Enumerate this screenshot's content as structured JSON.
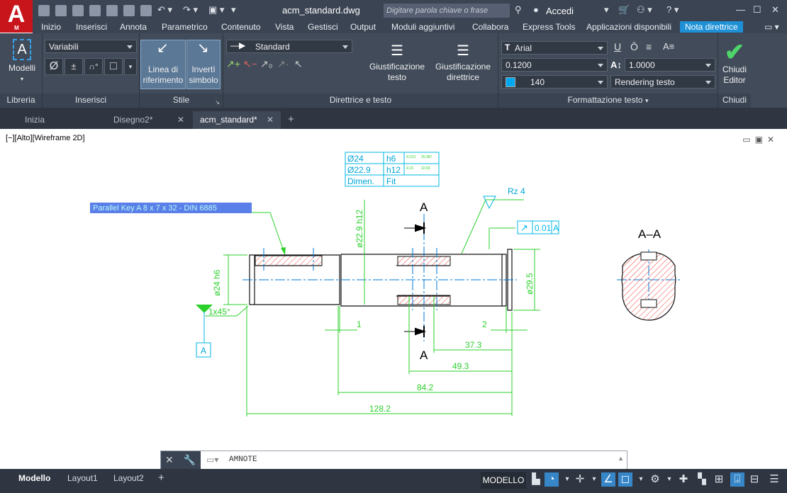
{
  "app": {
    "logo_letter": "A",
    "logo_sub": "M",
    "document_title": "acm_standard.dwg"
  },
  "search": {
    "placeholder": "Digitare parola chiave o frase"
  },
  "user": {
    "login": "Accedi"
  },
  "menu_tabs": [
    "Inizio",
    "Inserisci",
    "Annota",
    "Parametrico",
    "Contenuto",
    "Vista",
    "Gestisci",
    "Output",
    "Moduli aggiuntivi",
    "Collabora",
    "Express Tools",
    "Applicazioni disponibili",
    "Nota direttrice"
  ],
  "ribbon": {
    "libreria": {
      "label": "Libreria",
      "button": "Modelli"
    },
    "inserisci": {
      "label": "Inserisci",
      "combo": "Variabili",
      "symbols": [
        "Ø",
        "±",
        "∩°",
        "□"
      ]
    },
    "stile": {
      "label": "Stile",
      "btn1": "Linea di riferimento",
      "btn2": "Invertì simbolo"
    },
    "direttrice": {
      "label": "Direttrice e testo",
      "style_combo": "Standard",
      "btn1": "Giustificazione testo",
      "btn2": "Giustificazione direttrice"
    },
    "formattazione": {
      "label": "Formattazione testo",
      "font_combo": "Arial",
      "height_combo": "0.1200",
      "color_combo": "140",
      "scale_combo": "1.0000",
      "render_combo": "Rendering testo",
      "buttons": [
        "U",
        "Ō",
        "≡",
        "A≡"
      ]
    },
    "chiudi": {
      "label": "Chiudi",
      "button": "Chiudi Editor"
    }
  },
  "doc_tabs": [
    {
      "label": "Inizia"
    },
    {
      "label": "Disegno2*"
    },
    {
      "label": "acm_standard*"
    }
  ],
  "viewport": {
    "label": "[−][Alto][Wireframe 2D]"
  },
  "drawing": {
    "fit_table": [
      [
        "Ø24",
        "h6"
      ],
      [
        "Ø22.9",
        "h12"
      ],
      [
        "Dimen.",
        "Fit"
      ]
    ],
    "note": "Parallel Key  A 8 x 7 x 32 - DIN 6885",
    "roughness": "Rz 4",
    "section_letter": "A",
    "section_title": "A–A",
    "datum": "A",
    "runout": "0.01",
    "chamfer": "1x45°",
    "dims": {
      "d1": "ø24 h6",
      "d2": "ø22.9 h12",
      "d3": "ø29.5",
      "l1": "1",
      "l2": "2",
      "l3": "37.3",
      "l4": "49.3",
      "l5": "84.2",
      "l6": "128.2"
    }
  },
  "command": {
    "text": "AMNOTE"
  },
  "layout_tabs": [
    "Modello",
    "Layout1",
    "Layout2"
  ],
  "status": {
    "mode": "MODELLO"
  }
}
